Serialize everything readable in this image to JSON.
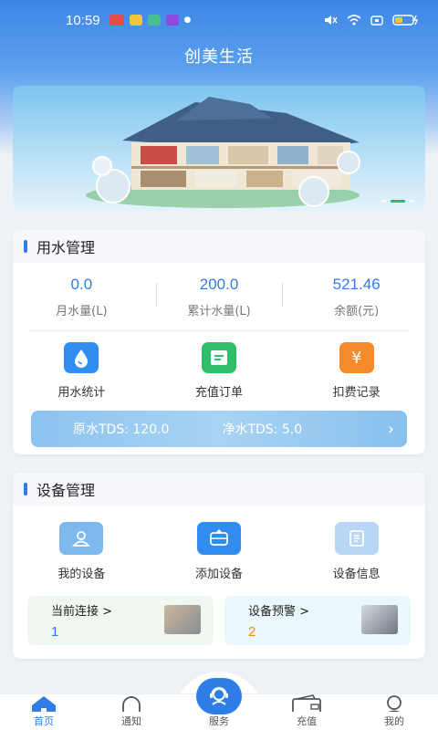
{
  "status_bar": {
    "time": "10:59"
  },
  "app": {
    "title": "创美生活"
  },
  "water_management": {
    "title": "用水管理",
    "stats": [
      {
        "value": "0.0",
        "label": "月水量(L)"
      },
      {
        "value": "200.0",
        "label": "累计水量(L)"
      },
      {
        "value": "521.46",
        "label": "余额(元)"
      }
    ],
    "actions": [
      {
        "label": "用水统计",
        "icon": "water-drop-icon",
        "color": "#2f8df0"
      },
      {
        "label": "充值订单",
        "icon": "receipt-icon",
        "color": "#2fbf6a"
      },
      {
        "label": "扣费记录",
        "icon": "yen-icon",
        "color": "#f58a2a"
      }
    ],
    "tds": {
      "raw_label": "原水TDS: 120.0",
      "pure_label": "净水TDS: 5.0"
    }
  },
  "device_management": {
    "title": "设备管理",
    "actions": [
      {
        "label": "我的设备",
        "icon": "user-device-icon"
      },
      {
        "label": "添加设备",
        "icon": "add-device-icon"
      },
      {
        "label": "设备信息",
        "icon": "device-info-icon"
      }
    ],
    "current_connection": {
      "label": "当前连接 >",
      "value": "1",
      "color": "#2f7de6"
    },
    "device_alert": {
      "label": "设备预警 >",
      "value": "2",
      "color": "#f08a1c"
    }
  },
  "tabs": [
    {
      "label": "首页",
      "icon": "home-icon"
    },
    {
      "label": "通知",
      "icon": "bell-icon"
    },
    {
      "label": "服务",
      "icon": "service-icon"
    },
    {
      "label": "充值",
      "icon": "wallet-icon"
    },
    {
      "label": "我的",
      "icon": "profile-icon"
    }
  ],
  "colors": {
    "accent": "#2f7de6",
    "header": "#3e86e6"
  }
}
